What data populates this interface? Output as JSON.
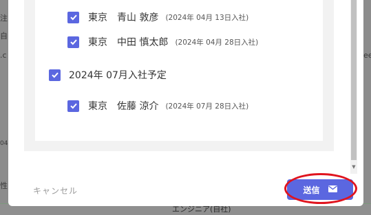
{
  "background": {
    "left_fragments": [
      "注",
      "自",
      ".c",
      "04",
      "性"
    ],
    "right_fragment": "ee",
    "bottom_text": "エンジニア(自社)"
  },
  "dialog": {
    "entries": [
      {
        "type": "person",
        "checked": true,
        "location": "東京",
        "name": "青山 敦彦",
        "date": "(2024年 04月 13日入社)"
      },
      {
        "type": "person",
        "checked": true,
        "location": "東京",
        "name": "中田 慎太郎",
        "date": "(2024年 04月 28日入社)"
      },
      {
        "type": "group",
        "checked": true,
        "label": "2024年 07月入社予定"
      },
      {
        "type": "person",
        "checked": true,
        "location": "東京",
        "name": "佐藤 涼介",
        "date": "(2024年 07月 28日入社)"
      }
    ],
    "cancel_label": "キャンセル",
    "send_label": "送信",
    "send_icon": "mail-icon",
    "accent_color": "#5b67e0",
    "highlight_color": "#e0141e"
  }
}
